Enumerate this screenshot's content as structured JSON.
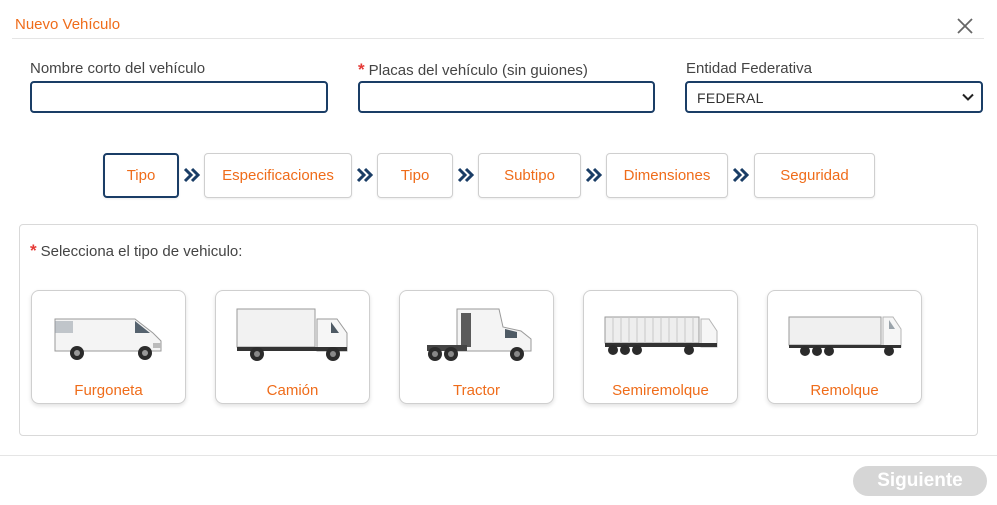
{
  "modal": {
    "title": "Nuevo Vehículo"
  },
  "form": {
    "short_name": {
      "label": "Nombre corto del vehículo",
      "value": ""
    },
    "plates": {
      "required_mark": "*",
      "label": "Placas del vehículo (sin guiones)",
      "value": ""
    },
    "state": {
      "label": "Entidad Federativa",
      "selected": "FEDERAL"
    }
  },
  "steps": [
    {
      "label": "Tipo",
      "active": true
    },
    {
      "label": "Especificaciones",
      "active": false
    },
    {
      "label": "Tipo",
      "active": false
    },
    {
      "label": "Subtipo",
      "active": false
    },
    {
      "label": "Dimensiones",
      "active": false
    },
    {
      "label": "Seguridad",
      "active": false
    }
  ],
  "vehicle_panel": {
    "required_mark": "*",
    "label": "Selecciona el tipo de vehiculo:",
    "options": [
      {
        "label": "Furgoneta",
        "icon": "van-icon"
      },
      {
        "label": "Camión",
        "icon": "truck-icon"
      },
      {
        "label": "Tractor",
        "icon": "tractor-icon"
      },
      {
        "label": "Semiremolque",
        "icon": "semitrailer-icon"
      },
      {
        "label": "Remolque",
        "icon": "trailer-icon"
      }
    ]
  },
  "footer": {
    "next_label": "Siguiente",
    "next_enabled": false
  },
  "colors": {
    "accent": "#ef6c1a",
    "border_active": "#1a3d66",
    "required": "#e53935",
    "button_disabled": "#d6d6d6"
  }
}
